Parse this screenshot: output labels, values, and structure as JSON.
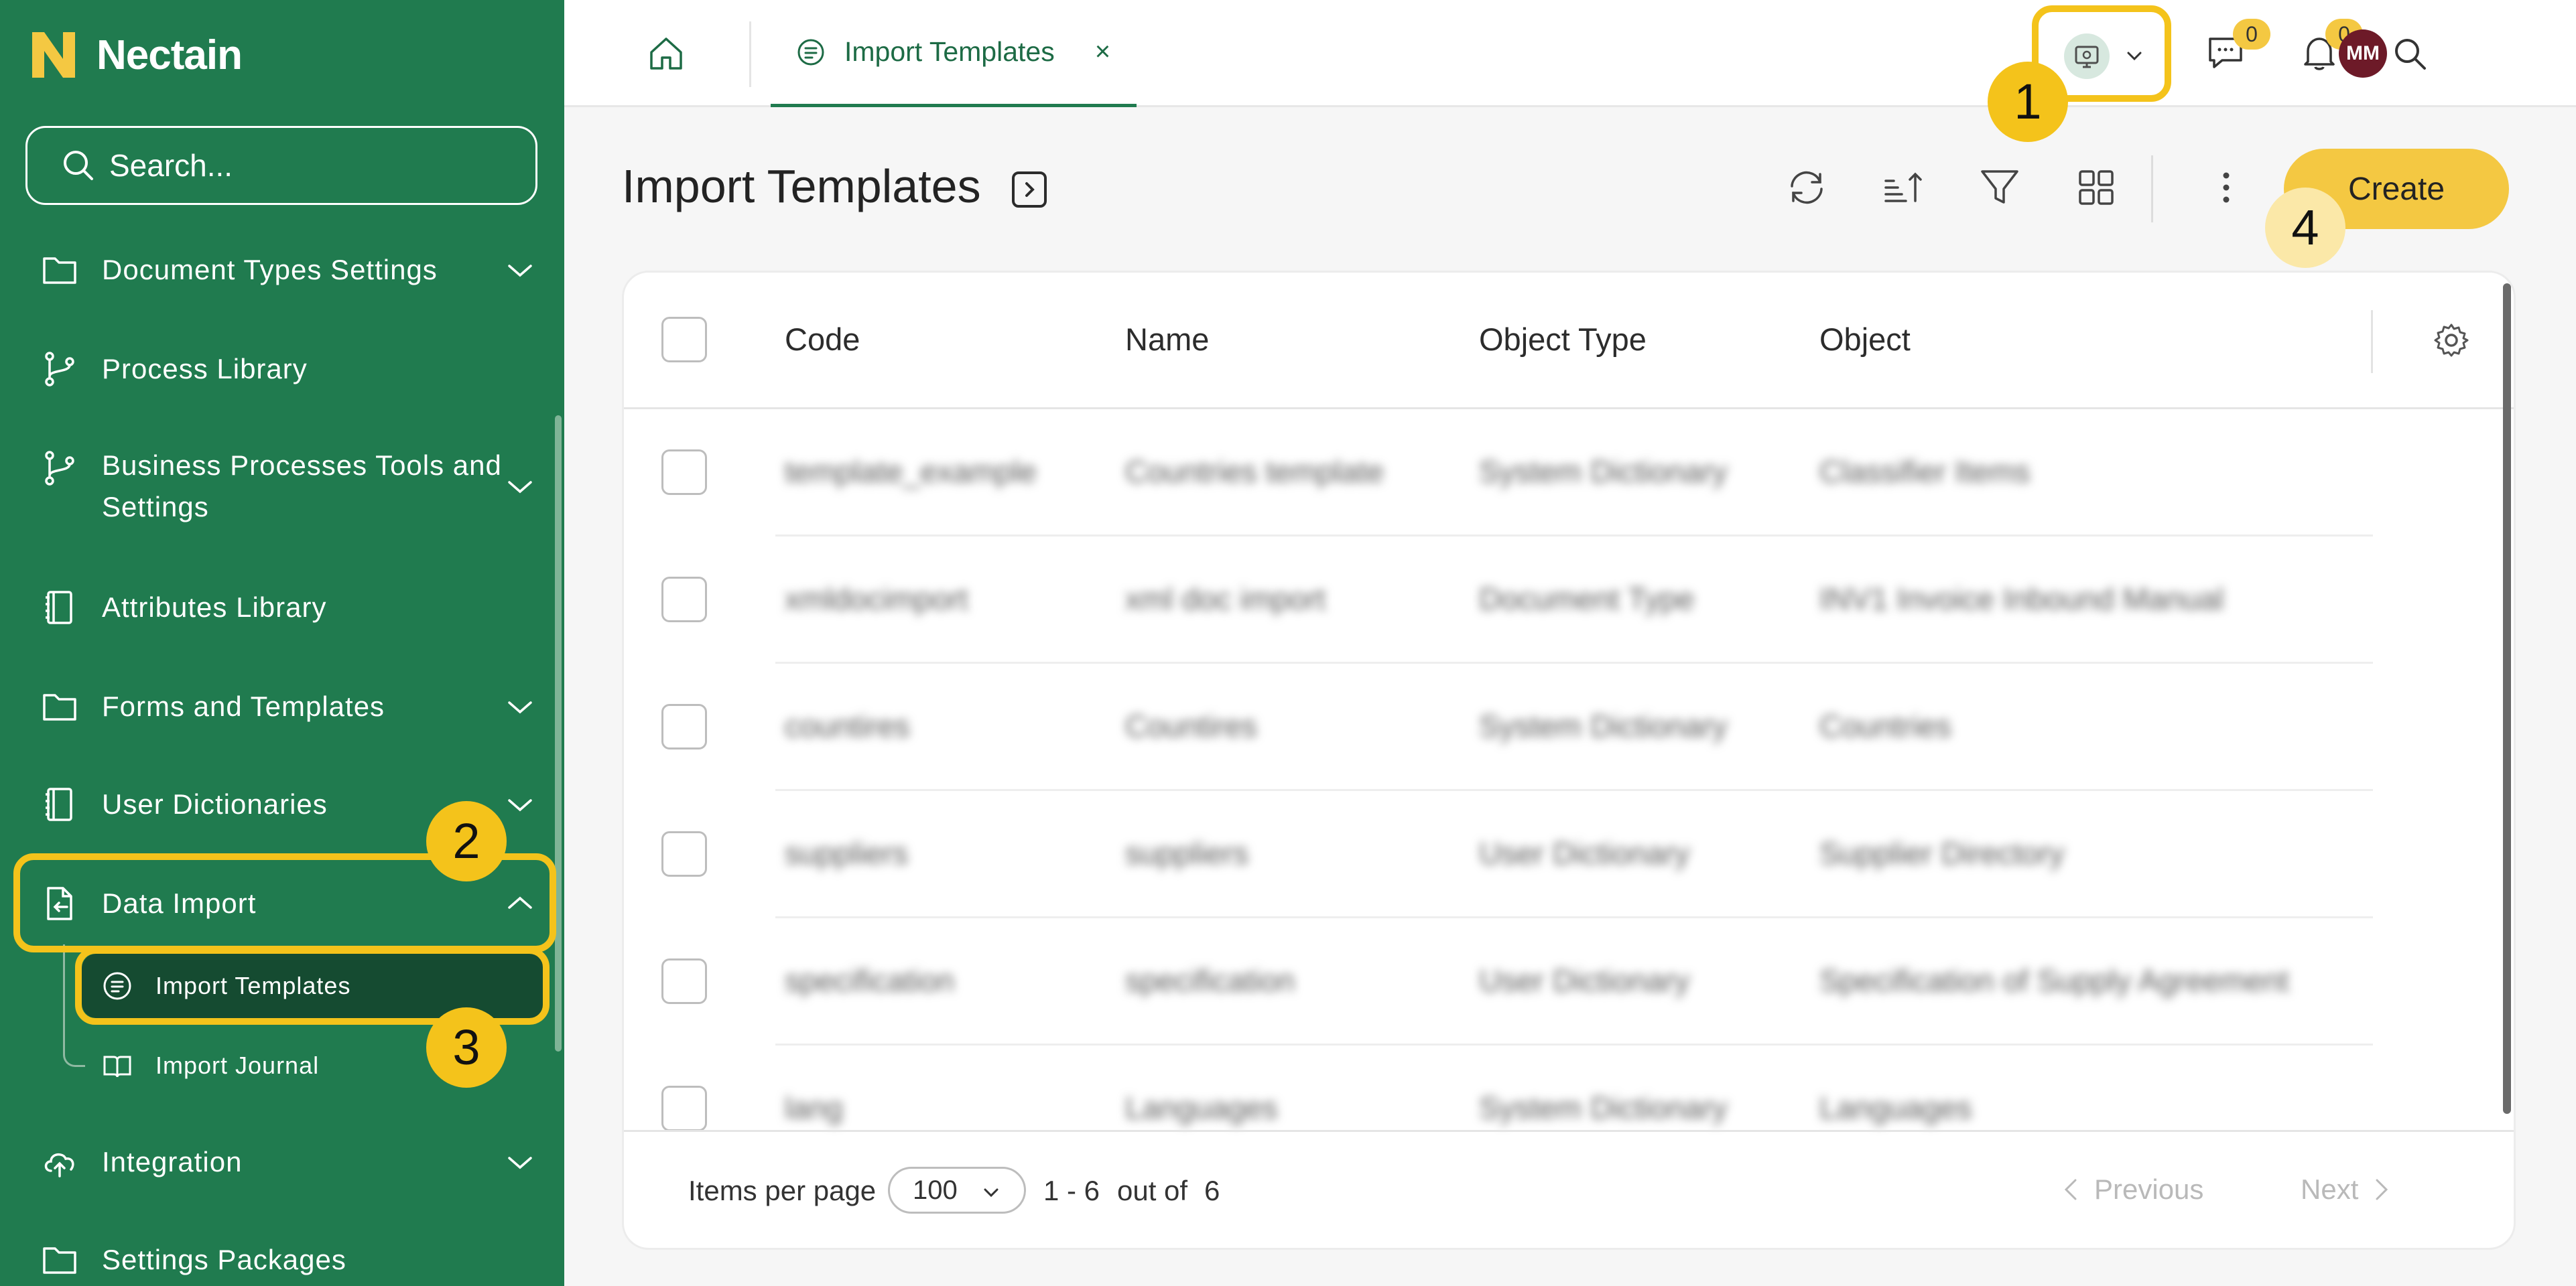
{
  "sidebar": {
    "brand": "Nectain",
    "search_placeholder": "Search...",
    "items": [
      {
        "label": "Document Types Settings",
        "icon": "folder-icon"
      },
      {
        "label": "Process Library",
        "icon": "branch-icon"
      },
      {
        "label": "Business Processes Tools and Settings",
        "icon": "branch-icon"
      },
      {
        "label": "Attributes Library",
        "icon": "notebook-icon"
      },
      {
        "label": "Forms and Templates",
        "icon": "folder-icon"
      },
      {
        "label": "User Dictionaries",
        "icon": "notebook-icon"
      },
      {
        "label": "Data Import",
        "icon": "file-import-icon"
      },
      {
        "label": "Integration",
        "icon": "cloud-upload-icon"
      },
      {
        "label": "Settings Packages",
        "icon": "folder-icon"
      }
    ],
    "sub_items": [
      {
        "label": "Import Templates",
        "icon": "template-icon",
        "active": true
      },
      {
        "label": "Import Journal",
        "icon": "book-icon",
        "active": false
      }
    ]
  },
  "topbar": {
    "tab_label": "Import Templates",
    "tab_close": "×",
    "messages_count": "0",
    "notifications_count": "0",
    "avatar_initials": "MM"
  },
  "main": {
    "title": "Import Templates",
    "create_label": "Create"
  },
  "table": {
    "columns": [
      "Code",
      "Name",
      "Object Type",
      "Object"
    ],
    "rows": [
      [
        "template_example",
        "Countries template",
        "System Dictionary",
        "Classifier Items"
      ],
      [
        "xmldocimport",
        "xml doc import",
        "Document Type",
        "INV1 Invoice Inbound Manual"
      ],
      [
        "countires",
        "Countires",
        "System Dictionary",
        "Countries"
      ],
      [
        "suppliers",
        "suppliers",
        "User Dictionary",
        "Supplier Directory"
      ],
      [
        "specification",
        "specification",
        "User Dictionary",
        "Specification of Supply Agreement"
      ],
      [
        "lang",
        "Languages",
        "System Dictionary",
        "Languages"
      ]
    ]
  },
  "footer": {
    "items_per_page_label": "Items per page",
    "per_page_value": "100",
    "range": "1 - 6",
    "out_of_label": "out of",
    "total": "6",
    "previous_label": "Previous",
    "next_label": "Next"
  },
  "annotations": {
    "callout_1": "1",
    "callout_2": "2",
    "callout_3": "3",
    "callout_4": "4",
    "highlight_color": "#f4c31b"
  },
  "colors": {
    "sidebar_bg": "#207b4f",
    "sidebar_active_bg": "#154b31",
    "accent_green": "#1d6b45",
    "create_button": "#f4c842",
    "avatar_bg": "#6d1a28"
  }
}
